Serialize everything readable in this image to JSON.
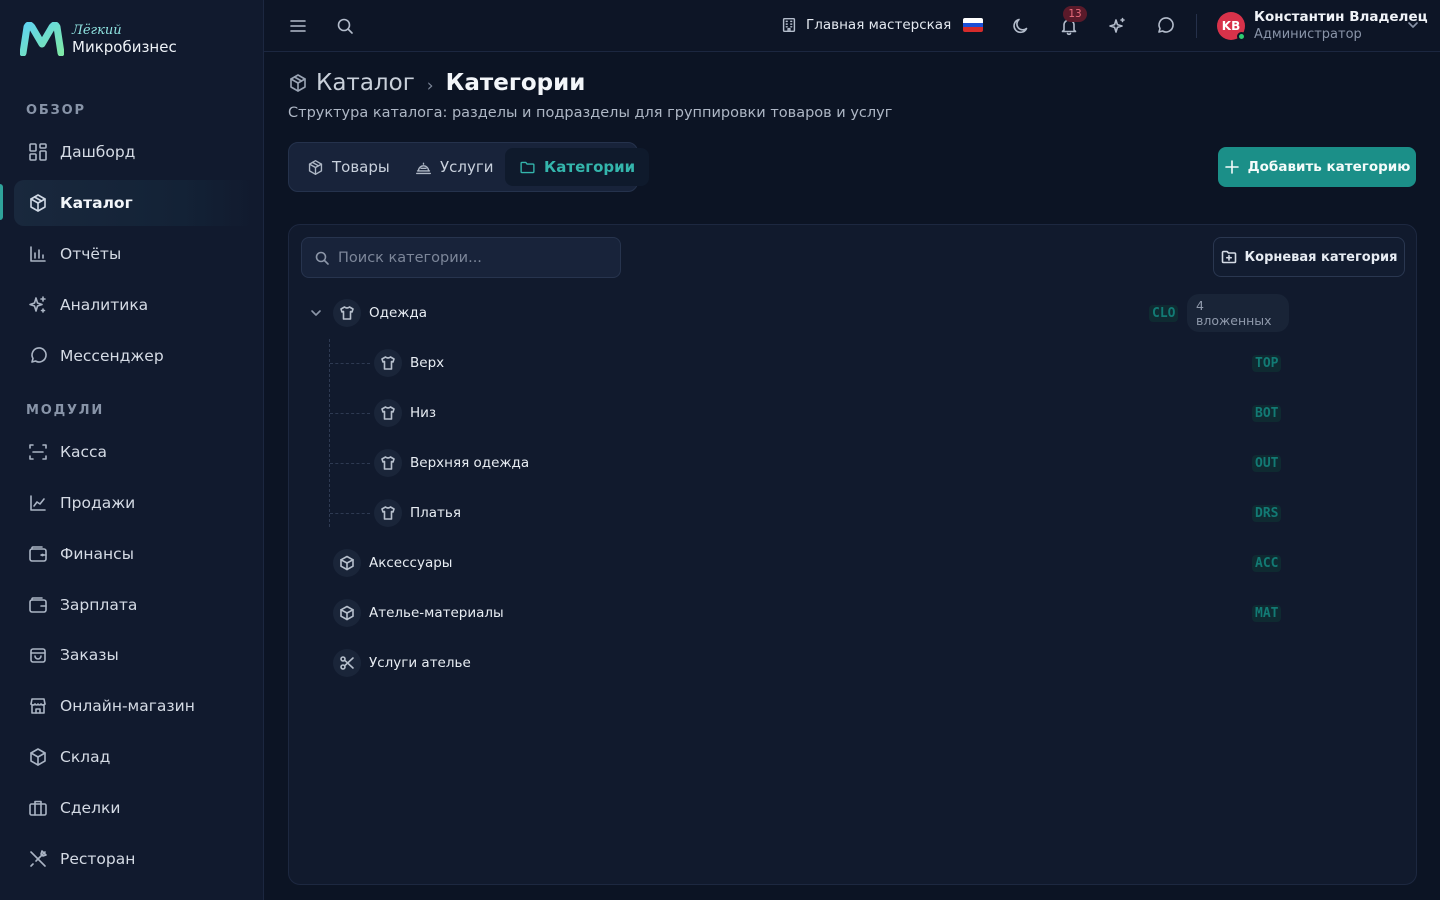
{
  "brand": {
    "line1": "Лёгкий",
    "line2": "Микробизнес"
  },
  "sidebar": {
    "sections": [
      {
        "title": "ОБЗОР",
        "items": [
          {
            "label": "Дашборд",
            "icon": "dashboard-icon"
          },
          {
            "label": "Каталог",
            "icon": "catalog-icon",
            "active": true
          },
          {
            "label": "Отчёты",
            "icon": "reports-icon"
          },
          {
            "label": "Аналитика",
            "icon": "sparkles-icon"
          },
          {
            "label": "Мессенджер",
            "icon": "message-icon"
          }
        ]
      },
      {
        "title": "МОДУЛИ",
        "items": [
          {
            "label": "Касса",
            "icon": "scan-icon"
          },
          {
            "label": "Продажи",
            "icon": "trend-icon"
          },
          {
            "label": "Финансы",
            "icon": "wallet-icon"
          },
          {
            "label": "Зарплата",
            "icon": "wallet-icon"
          },
          {
            "label": "Заказы",
            "icon": "bag-icon"
          },
          {
            "label": "Онлайн-магазин",
            "icon": "store-icon"
          },
          {
            "label": "Склад",
            "icon": "box-icon"
          },
          {
            "label": "Сделки",
            "icon": "briefcase-icon"
          },
          {
            "label": "Ресторан",
            "icon": "utensils-icon"
          }
        ]
      }
    ]
  },
  "header": {
    "workshop": "Главная мастерская",
    "notifications_count": "13",
    "user": {
      "initials": "KB",
      "name": "Константин Владелец",
      "role": "Администратор"
    }
  },
  "page": {
    "breadcrumb_parent": "Каталог",
    "breadcrumb_sep": "›",
    "title": "Категории",
    "subtitle": "Структура каталога: разделы и подразделы для группировки товаров и услуг",
    "tabs": [
      {
        "label": "Товары",
        "icon": "catalog-icon"
      },
      {
        "label": "Услуги",
        "icon": "services-icon"
      },
      {
        "label": "Категории",
        "icon": "folder-icon",
        "active": true
      }
    ],
    "add_button": "Добавить категорию"
  },
  "panel": {
    "search_placeholder": "Поиск категории...",
    "root_button": "Корневая категория",
    "categories": [
      {
        "name": "Одежда",
        "code": "CLO",
        "nested": "4 вложенных",
        "icon": "shirt-icon",
        "expanded": true,
        "children": [
          {
            "name": "Верх",
            "code": "TOP",
            "icon": "shirt-icon"
          },
          {
            "name": "Низ",
            "code": "BOT",
            "icon": "shirt-icon"
          },
          {
            "name": "Верхняя одежда",
            "code": "OUT",
            "icon": "shirt-icon"
          },
          {
            "name": "Платья",
            "code": "DRS",
            "icon": "shirt-icon"
          }
        ]
      },
      {
        "name": "Аксессуары",
        "code": "ACC",
        "icon": "box-icon"
      },
      {
        "name": "Ателье-материалы",
        "code": "MAT",
        "icon": "box-icon"
      },
      {
        "name": "Услуги ателье",
        "code": "",
        "icon": "scissors-icon"
      }
    ]
  },
  "colors": {
    "accent": "#1b8f88",
    "accent_text": "#34b5ac",
    "background": "#0c1424",
    "sidebar": "#111a2e"
  }
}
